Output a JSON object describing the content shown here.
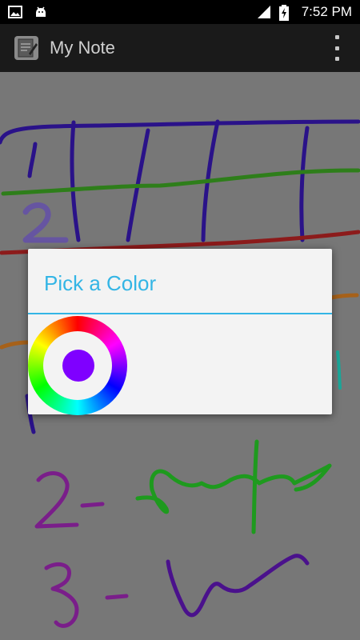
{
  "status_bar": {
    "time": "7:52 PM"
  },
  "action_bar": {
    "title": "My Note",
    "app_icon": "notepad-icon",
    "menu_icon": "overflow-menu-icon"
  },
  "canvas": {
    "label_1": "1",
    "label_2": "2",
    "label_3": "2-",
    "label_4": "3-"
  },
  "dialog": {
    "title": "Pick a Color",
    "selected_color": "#7f00ff",
    "accent": "#33b5e5"
  }
}
